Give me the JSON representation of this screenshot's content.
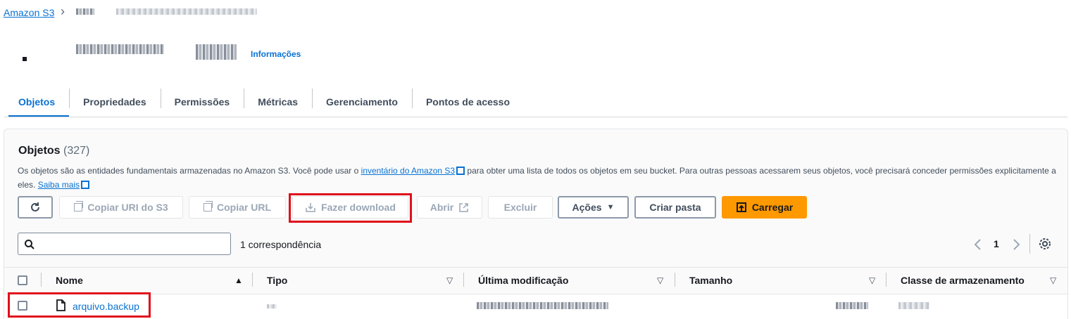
{
  "breadcrumb": {
    "root": "Amazon S3"
  },
  "header": {
    "info_link": "Informações"
  },
  "tabs": [
    {
      "label": "Objetos"
    },
    {
      "label": "Propriedades"
    },
    {
      "label": "Permissões"
    },
    {
      "label": "Métricas"
    },
    {
      "label": "Gerenciamento"
    },
    {
      "label": "Pontos de acesso"
    }
  ],
  "objects": {
    "title": "Objetos",
    "count": "(327)",
    "desc_1": "Os objetos são as entidades fundamentais armazenadas no Amazon S3. Você pode usar o ",
    "desc_link_1": "inventário do Amazon S3",
    "desc_2": " para obter uma lista de todos os objetos em seu bucket. Para outras pessoas acessarem seus objetos, você precisará conceder permissões explicitamente a eles. ",
    "desc_link_2": "Saiba mais"
  },
  "toolbar": {
    "copy_uri": "Copiar URI do S3",
    "copy_url": "Copiar URL",
    "download": "Fazer download",
    "open": "Abrir",
    "delete": "Excluir",
    "actions": "Ações",
    "create_folder": "Criar pasta",
    "upload": "Carregar"
  },
  "search": {
    "placeholder": "",
    "match": "1 correspondência"
  },
  "pagination": {
    "page": "1"
  },
  "table": {
    "columns": [
      "Nome",
      "Tipo",
      "Última modificação",
      "Tamanho",
      "Classe de armazenamento"
    ],
    "rows": [
      {
        "name": "arquivo.backup"
      }
    ]
  },
  "colors": {
    "link": "#0972d3",
    "primary": "#ff9900",
    "highlight": "#e0101b"
  }
}
